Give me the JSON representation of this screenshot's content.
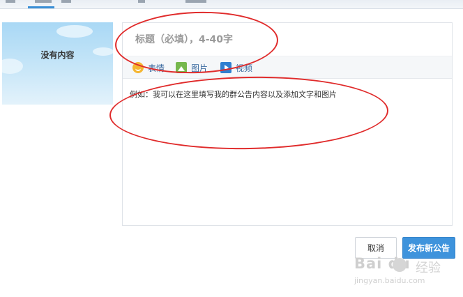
{
  "cover": {
    "empty_text": "没有内容"
  },
  "editor": {
    "title_placeholder": "标题（必填），4-40字",
    "content_placeholder": "例如：我可以在这里填写我的群公告内容以及添加文字和图片",
    "toolbar": [
      {
        "label": "表情",
        "icon": "smile-icon"
      },
      {
        "label": "图片",
        "icon": "image-icon"
      },
      {
        "label": "视频",
        "icon": "video-icon"
      }
    ]
  },
  "actions": {
    "cancel_label": "取消",
    "publish_label": "发布新公告"
  },
  "watermark": {
    "logo": "Bai du",
    "sub": "经验",
    "url": "jingyan.baidu.com"
  },
  "colors": {
    "accent": "#3e93dc",
    "annotation": "#e02b2b",
    "link": "#3a6aa0"
  }
}
